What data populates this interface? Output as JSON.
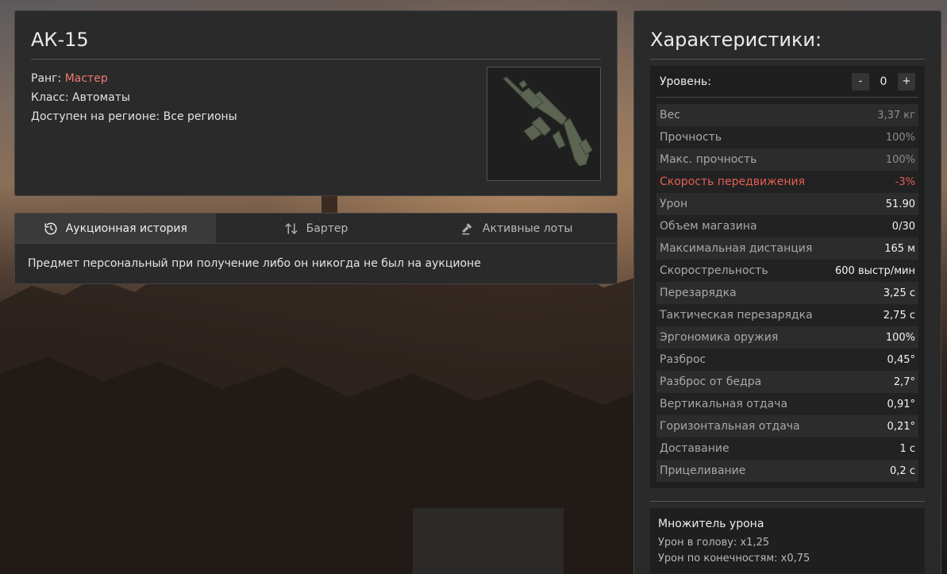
{
  "item": {
    "name": "АК-15",
    "rank_label": "Ранг: ",
    "rank_value": "Мастер",
    "class_text": "Класс: Автоматы",
    "region_text": "Доступен на регионе: Все регионы"
  },
  "auction": {
    "tabs": [
      {
        "label": "Аукционная история",
        "icon": "history-icon",
        "active": true
      },
      {
        "label": "Бартер",
        "icon": "swap-arrows-icon",
        "active": false
      },
      {
        "label": "Активные лоты",
        "icon": "gavel-icon",
        "active": false
      }
    ],
    "message": "Предмет персональный при получение либо он никогда не был на аукционе"
  },
  "stats": {
    "title": "Характеристики:",
    "level_label": "Уровень:",
    "level_minus": "-",
    "level_value": "0",
    "level_plus": "+",
    "rows": [
      {
        "label": "Вес",
        "value": "3,37 кг",
        "style": "dim"
      },
      {
        "label": "Прочность",
        "value": "100%",
        "style": "dim"
      },
      {
        "label": "Макс. прочность",
        "value": "100%",
        "style": "dim"
      },
      {
        "label": "Скорость передвижения",
        "value": "-3%",
        "style": "neg"
      },
      {
        "label": "Урон",
        "value": "51.90",
        "style": ""
      },
      {
        "label": "Объем магазина",
        "value": "0/30",
        "style": ""
      },
      {
        "label": "Максимальная дистанция",
        "value": "165 м",
        "style": ""
      },
      {
        "label": "Скорострельность",
        "value": "600 выстр/мин",
        "style": ""
      },
      {
        "label": "Перезарядка",
        "value": "3,25 с",
        "style": ""
      },
      {
        "label": "Тактическая перезарядка",
        "value": "2,75 с",
        "style": ""
      },
      {
        "label": "Эргономика оружия",
        "value": "100%",
        "style": ""
      },
      {
        "label": "Разброс",
        "value": "0,45°",
        "style": ""
      },
      {
        "label": "Разброс от бедра",
        "value": "2,7°",
        "style": ""
      },
      {
        "label": "Вертикальная отдача",
        "value": "0,91°",
        "style": ""
      },
      {
        "label": "Горизонтальная отдача",
        "value": "0,21°",
        "style": ""
      },
      {
        "label": "Доставание",
        "value": "1 с",
        "style": ""
      },
      {
        "label": "Прицеливание",
        "value": "0,2 с",
        "style": ""
      }
    ],
    "multiplier": {
      "title": "Множитель урона",
      "head": "Урон в голову: x1,25",
      "limbs": "Урон по конечностям: x0,75"
    }
  },
  "colors": {
    "rank": "#ef7b74",
    "negative": "#e55d55"
  }
}
